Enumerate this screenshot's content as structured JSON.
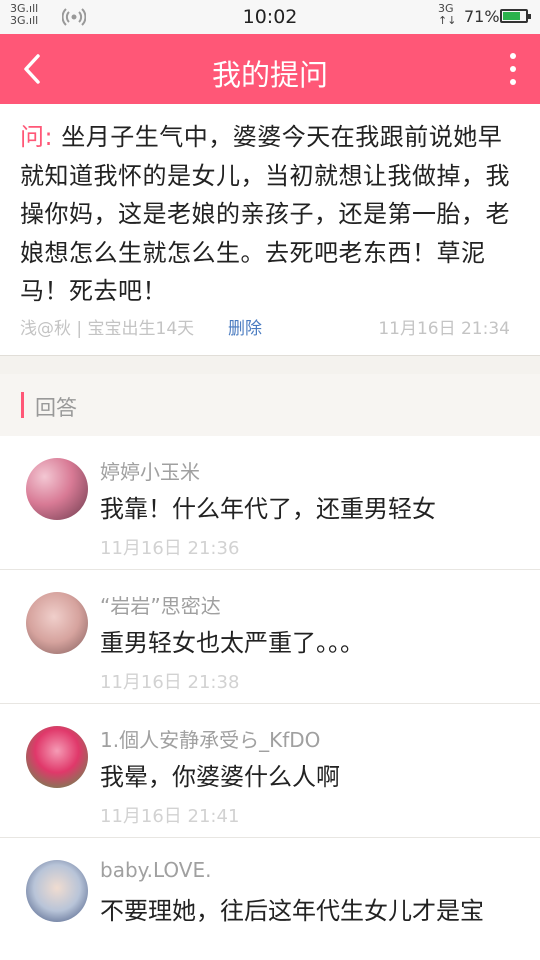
{
  "status_bar": {
    "signal_left_top": "3G",
    "signal_left_bottom": "3G",
    "time": "10:02",
    "network": "3G",
    "battery_text": "71%",
    "battery_level": 0.71,
    "battery_color": "#2bb24c"
  },
  "header": {
    "title": "我的提问",
    "back_icon": "chevron-left-icon",
    "more_icon": "more-vertical-icon",
    "bg_color": "#ff5777"
  },
  "question": {
    "prefix": "问:",
    "text": "坐月子生气中，婆婆今天在我跟前说她早就知道我怀的是女儿，当初就想让我做掉，我操你妈，这是老娘的亲孩子，还是第一胎，老娘想怎么生就怎么生。去死吧老东西！草泥马！死去吧！",
    "meta": "浅@秋 | 宝宝出生14天",
    "delete_label": "删除",
    "time": "11月16日 21:34"
  },
  "answers_section": {
    "title": "回答"
  },
  "answers": [
    {
      "name": "婷婷小玉米",
      "text": "我靠！什么年代了，还重男轻女",
      "time": "11月16日 21:36"
    },
    {
      "name": "“岩岩”思密达",
      "text": "重男轻女也太严重了。。。",
      "time": "11月16日 21:38"
    },
    {
      "name": "1.個人安静承受ら_KfDO",
      "text": "我晕，你婆婆什么人啊",
      "time": "11月16日 21:41"
    },
    {
      "name": "baby.LOVE.",
      "text": "不要理她，往后这年代生女儿才是宝",
      "time": ""
    }
  ]
}
